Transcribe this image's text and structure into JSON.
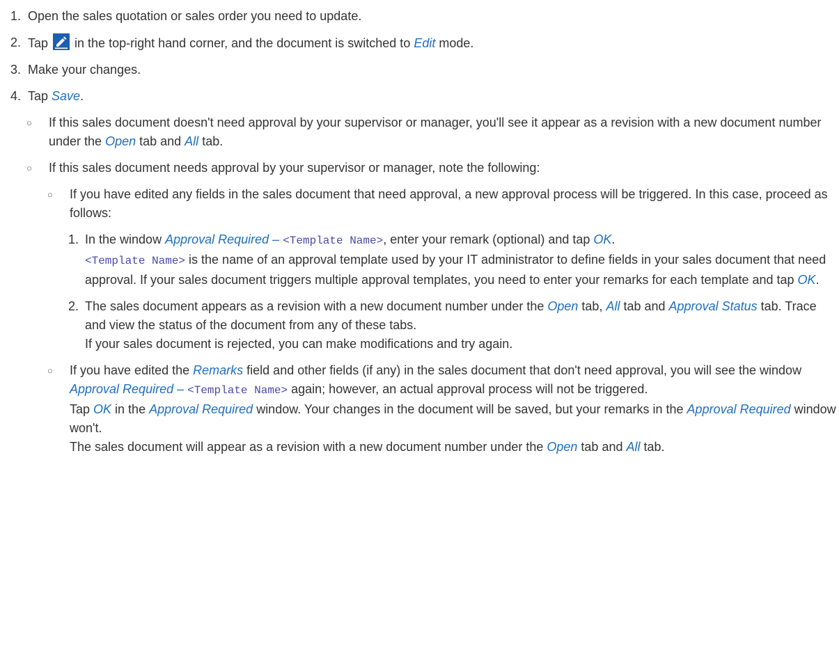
{
  "steps": [
    {
      "num": "1.",
      "text": "Open the sales quotation or sales order you need to update."
    },
    {
      "num": "2.",
      "pre": "Tap ",
      "post": " in the top-right hand corner, and the document is switched to ",
      "ui": "Edit",
      "tail": " mode.",
      "icon": "edit-pencil-icon"
    },
    {
      "num": "3.",
      "text": "Make your changes."
    },
    {
      "num": "4.",
      "pre": "Tap ",
      "ui": "Save",
      "tail": "."
    }
  ],
  "bullets": {
    "b1": {
      "a": "If this sales document doesn't need approval by your supervisor or manager, you'll see it appear as a revision with a new document number under the ",
      "open": "Open",
      "b": " tab and ",
      "all": "All",
      "c": " tab."
    },
    "b2": {
      "text": "If this sales document needs approval by your supervisor or manager, note the following:"
    },
    "b2a": {
      "text": "If you have edited any fields in the sales document that need approval, a new approval process will be triggered. In this case, proceed as follows:"
    },
    "s1": {
      "num": "1.",
      "a": "In the window ",
      "ui": "Approval Required – ",
      "mono": "<Template Name>",
      "b": ", enter your remark (optional) and tap ",
      "ok": "OK",
      "c": ".",
      "mono2": "<Template Name>",
      "d": " is the name of an approval template used by your IT administrator to define fields in your sales document that need approval. If your sales document triggers multiple approval templates, you need to enter your remarks for each template and tap ",
      "ok2": "OK",
      "e": "."
    },
    "s2": {
      "num": "2.",
      "a": "The sales document appears as a revision with a new document number under the ",
      "open": "Open",
      "b": " tab, ",
      "all": "All",
      "c": " tab and ",
      "approval": "Approval Status",
      "d": " tab. Trace and view the status of the document from any of these tabs.",
      "e": "If your sales document is rejected, you can make modifications and try again."
    },
    "b2b": {
      "a": "If you have edited the ",
      "remarks": "Remarks",
      "b": " field and other fields (if any) in the sales document that don't need approval, you will see the window ",
      "ui": "Approval Required – ",
      "mono": "<Template Name>",
      "c": " again; however, an actual approval process will not be triggered.",
      "d": "Tap ",
      "ok": "OK",
      "e": " in the ",
      "ar": "Approval Required",
      "f": " window. Your changes in the document will be saved, but your remarks in the ",
      "ar2": "Approval Required",
      "g": " window won't.",
      "h": "The sales document will appear as a revision with a new document number under the ",
      "open": "Open",
      "i": " tab and ",
      "all": "All",
      "j": " tab."
    }
  },
  "colors": {
    "accent": "#1f6fbf",
    "text": "#333333",
    "icon": "#1b5fb0"
  }
}
